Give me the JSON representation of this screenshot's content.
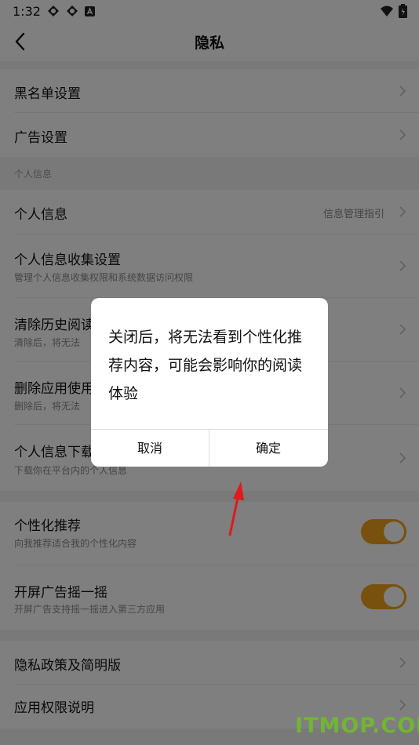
{
  "status_bar": {
    "time": "1:32"
  },
  "nav": {
    "title": "隐私"
  },
  "rows": {
    "blacklist": "黑名单设置",
    "ads": "广告设置",
    "section_personal": "个人信息",
    "personal_info": "个人信息",
    "personal_info_right": "信息管理指引",
    "collect": "个人信息收集设置",
    "collect_sub": "管理个人信息收集权限和系统数据访问权限",
    "clear_history": "清除历史阅读",
    "clear_history_sub": "清除后，将无法",
    "delete_app": "删除应用使用",
    "delete_app_sub": "删除后，将无法",
    "download": "个人信息下载",
    "download_sub": "下载你在平台内的个人信息",
    "recommend": "个性化推荐",
    "recommend_sub": "向我推荐适合我的个性化内容",
    "shake": "开屏广告摇一摇",
    "shake_sub": "开屏广告支持摇一摇进入第三方应用",
    "policy": "隐私政策及简明版",
    "permissions": "应用权限说明"
  },
  "toggles": {
    "recommend_on": true,
    "shake_on": true
  },
  "dialog": {
    "message": "关闭后，将无法看到个性化推荐内容，可能会影响你的阅读体验",
    "cancel": "取消",
    "confirm": "确定"
  },
  "watermark": "ITMOP.COM",
  "colors": {
    "accent": "#f1a21c",
    "arrow": "#e0191b"
  }
}
